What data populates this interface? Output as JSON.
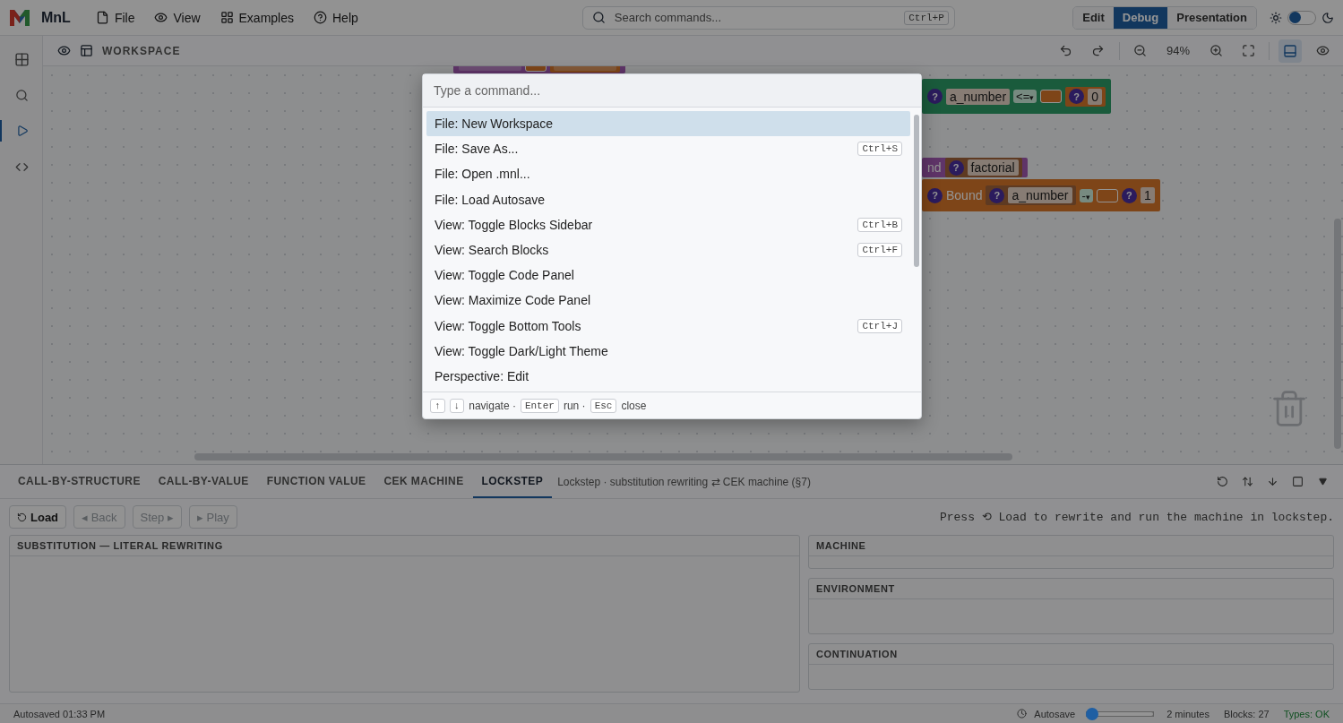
{
  "topbar": {
    "app_name": "MnL",
    "menus": [
      {
        "kind": "file",
        "label": "File"
      },
      {
        "kind": "view",
        "label": "View"
      },
      {
        "kind": "examples",
        "label": "Examples"
      },
      {
        "kind": "help",
        "label": "Help"
      }
    ],
    "search": {
      "placeholder": "Search commands...",
      "shortcut": "Ctrl+P"
    },
    "perspectives": [
      {
        "label": "Edit",
        "selected": false
      },
      {
        "label": "Debug",
        "selected": true
      },
      {
        "label": "Presentation",
        "selected": false
      }
    ],
    "theme_toggle": {
      "on": false
    }
  },
  "activity_bar": [
    {
      "kind": "blocks",
      "selected": false
    },
    {
      "kind": "search",
      "selected": false
    },
    {
      "kind": "run",
      "selected": true
    },
    {
      "kind": "code",
      "selected": false
    }
  ],
  "workspace": {
    "title": "WORKSPACE",
    "zoom": "94%",
    "bottom_panel_on": true,
    "blocks": [
      {
        "kind": "definition",
        "parts": [
          {
            "kind": "strip"
          },
          {
            "kind": "slot"
          },
          {
            "kind": "value",
            "parts": [
              {
                "kind": "strip"
              }
            ]
          }
        ]
      },
      {
        "kind": "comparison",
        "parts": [
          {
            "kind": "help",
            "text": "?"
          },
          {
            "kind": "chip",
            "text": "a_number"
          },
          {
            "kind": "dropdown",
            "text": "<=",
            "arrow": "▾"
          },
          {
            "kind": "slot"
          },
          {
            "kind": "value",
            "parts": [
              {
                "kind": "help",
                "text": "?"
              },
              {
                "kind": "chip",
                "text": "0"
              }
            ]
          }
        ]
      },
      {
        "kind": "definition",
        "parts": [
          {
            "kind": "label",
            "text": "nd"
          },
          {
            "kind": "variable",
            "parts": [
              {
                "kind": "help",
                "text": "?"
              },
              {
                "kind": "chip",
                "text": "factorial"
              }
            ]
          }
        ]
      },
      {
        "kind": "value",
        "parts": [
          {
            "kind": "help",
            "text": "?"
          },
          {
            "kind": "label",
            "text": "Bound"
          },
          {
            "kind": "variable",
            "parts": [
              {
                "kind": "help",
                "text": "?"
              },
              {
                "kind": "chip",
                "text": "a_number"
              }
            ]
          },
          {
            "kind": "dropdown",
            "text": "-",
            "arrow": "▾"
          },
          {
            "kind": "slot"
          },
          {
            "kind": "help",
            "text": "?"
          },
          {
            "kind": "chip",
            "text": "1"
          }
        ]
      }
    ]
  },
  "palette": {
    "placeholder": "Type a command...",
    "items": [
      {
        "label": "File: New Workspace",
        "selected": true
      },
      {
        "label": "File: Save As...",
        "shortcut": "Ctrl+S",
        "selected": false
      },
      {
        "label": "File: Open .mnl...",
        "selected": false
      },
      {
        "label": "File: Load Autosave",
        "selected": false
      },
      {
        "label": "View: Toggle Blocks Sidebar",
        "shortcut": "Ctrl+B",
        "selected": false
      },
      {
        "label": "View: Search Blocks",
        "shortcut": "Ctrl+F",
        "selected": false
      },
      {
        "label": "View: Toggle Code Panel",
        "selected": false
      },
      {
        "label": "View: Maximize Code Panel",
        "selected": false
      },
      {
        "label": "View: Toggle Bottom Tools",
        "shortcut": "Ctrl+J",
        "selected": false
      },
      {
        "label": "View: Toggle Dark/Light Theme",
        "selected": false
      },
      {
        "label": "Perspective: Edit",
        "selected": false
      }
    ],
    "hints": [
      {
        "keys": [
          "↑",
          "↓"
        ],
        "label": "navigate ·"
      },
      {
        "keys": [
          "Enter"
        ],
        "label": "run ·"
      },
      {
        "keys": [
          "Esc"
        ],
        "label": "close"
      }
    ]
  },
  "bottom": {
    "tabs": [
      {
        "label": "CALL-BY-STRUCTURE",
        "selected": false
      },
      {
        "label": "CALL-BY-VALUE",
        "selected": false
      },
      {
        "label": "FUNCTION VALUE",
        "selected": false
      },
      {
        "label": "CEK MACHINE",
        "selected": false
      },
      {
        "label": "LOCKSTEP",
        "selected": true
      }
    ],
    "description": "Lockstep · substitution rewriting ⇄ CEK machine (§7)",
    "buttons": [
      {
        "kind": "load",
        "label": "Load",
        "disabled": false
      },
      {
        "kind": "plain",
        "label": "◂ Back",
        "disabled": true
      },
      {
        "kind": "plain",
        "label": "Step ▸",
        "disabled": true
      },
      {
        "kind": "plain",
        "label": "▸ Play",
        "disabled": true
      }
    ],
    "message": "Press ⟲ Load to rewrite and run the machine in lockstep.",
    "left_panel": "SUBSTITUTION — LITERAL REWRITING",
    "right_panels": [
      "MACHINE",
      "ENVIRONMENT",
      "CONTINUATION"
    ]
  },
  "status_bar": {
    "autosaved": "Autosaved 01:33 PM",
    "autosave_label": "Autosave",
    "autosave_interval": {
      "level": 0
    },
    "interval_text": "2 minutes",
    "blocks": "Blocks: 27",
    "types": "Types: OK"
  }
}
